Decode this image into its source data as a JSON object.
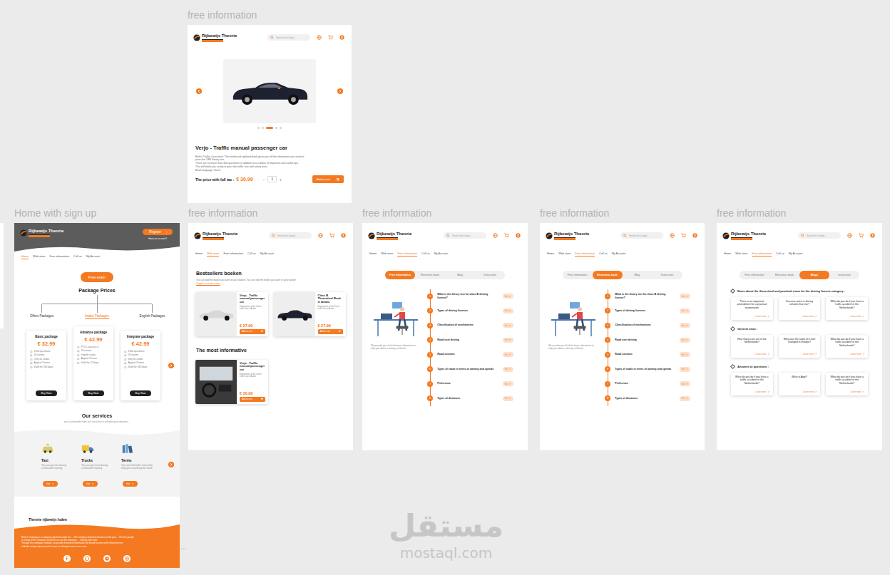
{
  "canvas": {
    "watermark": {
      "script": "مستقل",
      "domain": "mostaql.com"
    },
    "overflow_mark": "..."
  },
  "brand": {
    "name": "Rijbewijs Theorie"
  },
  "search": {
    "placeholder": "Search for a book..."
  },
  "frames": [
    {
      "kind": "product",
      "label": "free information",
      "carousel": {
        "dots": [
          {
            "selected": false
          },
          {
            "selected": false
          },
          {
            "selected": true
          },
          {
            "selected": false
          },
          {
            "selected": false
          }
        ]
      },
      "product": {
        "title": "Verjo - Traffic manual passenger car",
        "description": [
          "Beth's Traffic class book: This reinforced updated book gives you all the information you need to",
          "pass the CBR theory test.",
          "There are no fewer than 400 questions in addition to a number of important and useful tips.",
          "This will make you ready to pass the traffic test and safety tests.",
          "Book language: Dutch"
        ],
        "price_label": "The price with full tax :",
        "price": "€ 30.99",
        "minus": "−",
        "quantity": "1",
        "plus": "+",
        "button": "Add to cart"
      }
    },
    {
      "kind": "home",
      "label": "Home with sign up",
      "register": "Register",
      "account_prompt": "Have an account?",
      "nav": [
        {
          "label": "Home",
          "selected": true
        },
        {
          "label": "Web store",
          "selected": false
        },
        {
          "label": "Free information",
          "selected": false
        },
        {
          "label": "Call us",
          "selected": false
        },
        {
          "label": "My Account",
          "selected": false
        }
      ],
      "free_exam": "Free exam",
      "packages_title": "Package Prices",
      "package_tabs": [
        {
          "label": "Offers Packages",
          "selected": false
        },
        {
          "label": "Arabic Packages",
          "selected": true
        },
        {
          "label": "English Packages",
          "selected": false
        }
      ],
      "packages": [
        {
          "name": "Basic package",
          "price": "€ 32.99",
          "features": [
            "1500 questions",
            "30 exams",
            "Only on arabic",
            "Appeal 3 times",
            "Valid for 180 days"
          ],
          "button": "Buy Now"
        },
        {
          "name": "Advance package",
          "price": "€ 42.99",
          "features": [
            "PTCC practice 3",
            "20 exams",
            "english arabic",
            "Appeal 3 times",
            "Valid for 12 days"
          ],
          "button": "Buy Now"
        },
        {
          "name": "Integrate package",
          "price": "€ 42.99",
          "features": [
            "1500 questions",
            "30 exams",
            "only for arabic",
            "Appeal 3 times",
            "Valid for 180 days"
          ],
          "button": "Buy Now"
        }
      ],
      "services_title": "Our services",
      "services_subtitle": "you can benefit from our services to achieve your dreams...",
      "services": [
        {
          "kind": "taxi",
          "name": "Taxi",
          "text": "You can get taxi driving certification training",
          "button": "Go"
        },
        {
          "kind": "truck",
          "name": "Trucks",
          "text": "You can get truck driving certification training",
          "button": "Go"
        },
        {
          "kind": "books",
          "name": "Terms",
          "text": "You can find traffic terms that help you in passing the exam",
          "button": "Go"
        }
      ],
      "footer": {
        "title": "Theorie rijbewijs halen",
        "lines": [
          "Hotel e Company is a company registered under the ... The company started its business in the past ... The first people",
          "in charge of the company's business are two the employee ... starting point Gym.",
          "Through this company's website, we provide theoretical information for driving lessons to the driving license",
          "in Arabic and provide practical lessons for driving lessons in our area."
        ]
      }
    },
    {
      "kind": "store",
      "label": "free information",
      "nav": [
        {
          "label": "Home",
          "selected": false
        },
        {
          "label": "Web store",
          "selected": true
        },
        {
          "label": "Free information",
          "selected": false
        },
        {
          "label": "Call us",
          "selected": false
        },
        {
          "label": "My Account",
          "selected": false
        }
      ],
      "bestsellers_title": "Bestsellers boeken",
      "bestsellers_note": "You can add the books you want to your basket. You can edit the books you want in your basket",
      "bestsellers_link": "Toggle to create a view",
      "bestsellers": [
        {
          "title": "Verjo - Traffic manual passenger car",
          "text": "Explanation of the Dutch traffic law in Arabic",
          "price": "€ 27.99",
          "button": "Add to cart"
        },
        {
          "title": "Class B Theoretical Book in Arabic",
          "text": "Explanation of the Dutch traffic law in Arabic",
          "price": "€ 27.99",
          "button": "Add to cart"
        }
      ],
      "informative_title": "The most informative",
      "informative": [
        {
          "title": "Verjo - Traffic manual passenger car",
          "text": "Explanation of the Dutch traffic law in Arabic",
          "price": "€ 30.99",
          "button": "Add to cart"
        }
      ]
    },
    {
      "kind": "info",
      "label": "free information",
      "nav": [
        {
          "label": "Home",
          "selected": false
        },
        {
          "label": "Web store",
          "selected": false
        },
        {
          "label": "Free information",
          "selected": true
        },
        {
          "label": "Call us",
          "selected": false
        },
        {
          "label": "My Account",
          "selected": false
        }
      ],
      "tabs": [
        {
          "label": "Free information",
          "selected": true
        },
        {
          "label": "Electronic book",
          "selected": false
        },
        {
          "label": "Blog",
          "selected": false
        },
        {
          "label": "Instruction",
          "selected": false
        }
      ],
      "caption": "We provide you all of the basic information to help you obtain a driving certificate",
      "topics": [
        {
          "number": "1",
          "title": "What is the theory test for class B driving license?",
          "button": "Go"
        },
        {
          "number": "2",
          "title": "Types of driving licenses",
          "button": "Go"
        },
        {
          "number": "3",
          "title": "Classification of mechanisms",
          "button": "Go"
        },
        {
          "number": "4",
          "title": "Road user driving",
          "button": "Go"
        },
        {
          "number": "5",
          "title": "Road sections",
          "button": "Go"
        },
        {
          "number": "6",
          "title": "Types of roads in terms of owning and speeds",
          "button": "Go"
        },
        {
          "number": "7",
          "title": "Preference",
          "button": "Go"
        },
        {
          "number": "8",
          "title": "Types of distances",
          "button": "Go"
        }
      ]
    },
    {
      "kind": "info",
      "label": "free information",
      "nav": [
        {
          "label": "Home",
          "selected": false
        },
        {
          "label": "Web store",
          "selected": false
        },
        {
          "label": "Free information",
          "selected": true
        },
        {
          "label": "Call us",
          "selected": false
        },
        {
          "label": "My Account",
          "selected": false
        }
      ],
      "tabs": [
        {
          "label": "Free information",
          "selected": false
        },
        {
          "label": "Electronic book",
          "selected": true
        },
        {
          "label": "Blog",
          "selected": false
        },
        {
          "label": "Instruction",
          "selected": false
        }
      ],
      "caption": "We provide you all of the basic information to help you obtain a driving certificate",
      "topics": [
        {
          "number": "1",
          "title": "What is the theory test for class B driving license?",
          "button": "Go"
        },
        {
          "number": "2",
          "title": "Types of driving licenses",
          "button": "Go"
        },
        {
          "number": "3",
          "title": "Classification of mechanisms",
          "button": "Go"
        },
        {
          "number": "4",
          "title": "Road user driving",
          "button": "Go"
        },
        {
          "number": "5",
          "title": "Road sections",
          "button": "Go"
        },
        {
          "number": "6",
          "title": "Types of roads in terms of owning and speeds",
          "button": "Go"
        },
        {
          "number": "7",
          "title": "Preference",
          "button": "Go"
        },
        {
          "number": "8",
          "title": "Types of distances",
          "button": "Go"
        }
      ]
    },
    {
      "kind": "blog",
      "label": "free information",
      "nav": [
        {
          "label": "Home",
          "selected": false
        },
        {
          "label": "Web store",
          "selected": false
        },
        {
          "label": "Free information",
          "selected": true
        },
        {
          "label": "Call us",
          "selected": false
        },
        {
          "label": "My Account",
          "selected": false
        }
      ],
      "tabs": [
        {
          "label": "Free information",
          "selected": false
        },
        {
          "label": "Electronic book",
          "selected": false
        },
        {
          "label": "Blogs",
          "selected": true
        },
        {
          "label": "Instruction",
          "selected": false
        }
      ],
      "sections": [
        {
          "title": "News about the theoretical and practical exam for the driving license category :",
          "cards": [
            {
              "text": "There is an important amendment for a practical examination",
              "link": "Learn more"
            },
            {
              "text": "Success rates in driving schools that rise?",
              "link": "Learn more"
            },
            {
              "text": "What do you do if you have a traffic accident in the Netherlands?",
              "link": "Learn more"
            }
          ]
        },
        {
          "title": "General news :",
          "cards": [
            {
              "text": "How many cars are in the Netherlands?",
              "link": "Learn more"
            },
            {
              "text": "Why was the name of a fuel changed in Europe?",
              "link": "Learn more"
            },
            {
              "text": "What do you do if you have a traffic accident in the Netherlands?",
              "link": "Learn more"
            }
          ]
        },
        {
          "title": "Answers to questions :",
          "cards": [
            {
              "text": "What do you do if you have a traffic accident in the Netherlands?",
              "link": "Learn more"
            },
            {
              "text": "What is Appi?",
              "link": "Learn more"
            },
            {
              "text": "What do you do if you have a traffic accident in the Netherlands?",
              "link": "Learn more"
            }
          ]
        }
      ]
    }
  ]
}
